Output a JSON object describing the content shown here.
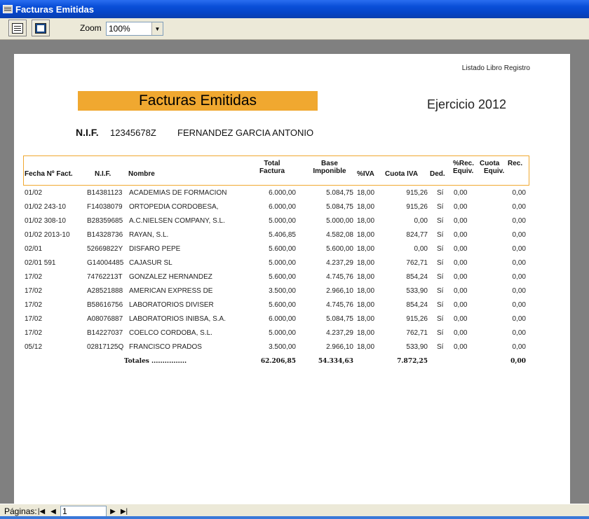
{
  "window": {
    "title": "Facturas Emitidas"
  },
  "toolbar": {
    "print_icon": "printer-icon",
    "close_icon": "close-report-icon",
    "zoom_label": "Zoom",
    "zoom_value": "100%"
  },
  "report": {
    "top_right": "Listado Libro Registro",
    "banner": "Facturas Emitidas",
    "banner_color": "#f0a830",
    "exercise": "Ejercicio 2012",
    "nif_label": "N.I.F.",
    "nif_value": "12345678Z",
    "holder_name": "FERNANDEZ GARCIA ANTONIO",
    "headers": {
      "fecha": "Fecha Nº Fact.",
      "nif": "N.I.F.",
      "nombre": "Nombre",
      "total_1": "Total",
      "total_2": "Factura",
      "base_1": "Base",
      "base_2": "Imponible",
      "iva": "%IVA",
      "cuota_iva": "Cuota IVA",
      "ded": "Ded.",
      "rec_1": "%Rec.",
      "rec_2": "Equiv.",
      "cuota_rec_1": "Cuota",
      "cuota_rec_2": "Equiv.",
      "rec_col": "Rec."
    },
    "rows": [
      {
        "fecha": "01/02",
        "nif": "B14381123",
        "nombre": "ACADEMIAS DE FORMACION",
        "total": "6.000,00",
        "base": "5.084,75",
        "iva": "18,00",
        "cuota": "915,26",
        "ded": "Sí",
        "rec": "0,00",
        "cuota_rec": "0,00"
      },
      {
        "fecha": "01/02 243-10",
        "nif": "F14038079",
        "nombre": "ORTOPEDIA CORDOBESA,",
        "total": "6.000,00",
        "base": "5.084,75",
        "iva": "18,00",
        "cuota": "915,26",
        "ded": "Sí",
        "rec": "0,00",
        "cuota_rec": "0,00"
      },
      {
        "fecha": "01/02 308-10",
        "nif": "B28359685",
        "nombre": "A.C.NIELSEN COMPANY, S.L.",
        "total": "5.000,00",
        "base": "5.000,00",
        "iva": "18,00",
        "cuota": "0,00",
        "ded": "Sí",
        "rec": "0,00",
        "cuota_rec": "0,00"
      },
      {
        "fecha": "01/02 2013-10",
        "nif": "B14328736",
        "nombre": "RAYAN, S.L.",
        "total": "5.406,85",
        "base": "4.582,08",
        "iva": "18,00",
        "cuota": "824,77",
        "ded": "Sí",
        "rec": "0,00",
        "cuota_rec": "0,00"
      },
      {
        "fecha": "02/01",
        "nif": "52669822Y",
        "nombre": "DISFARO PEPE",
        "total": "5.600,00",
        "base": "5.600,00",
        "iva": "18,00",
        "cuota": "0,00",
        "ded": "Sí",
        "rec": "0,00",
        "cuota_rec": "0,00"
      },
      {
        "fecha": "02/01 591",
        "nif": "G14004485",
        "nombre": "CAJASUR SL",
        "total": "5.000,00",
        "base": "4.237,29",
        "iva": "18,00",
        "cuota": "762,71",
        "ded": "Sí",
        "rec": "0,00",
        "cuota_rec": "0,00"
      },
      {
        "fecha": "17/02",
        "nif": "74762213T",
        "nombre": "GONZALEZ HERNANDEZ",
        "total": "5.600,00",
        "base": "4.745,76",
        "iva": "18,00",
        "cuota": "854,24",
        "ded": "Sí",
        "rec": "0,00",
        "cuota_rec": "0,00"
      },
      {
        "fecha": "17/02",
        "nif": "A28521888",
        "nombre": "AMERICAN EXPRESS DE",
        "total": "3.500,00",
        "base": "2.966,10",
        "iva": "18,00",
        "cuota": "533,90",
        "ded": "Sí",
        "rec": "0,00",
        "cuota_rec": "0,00"
      },
      {
        "fecha": "17/02",
        "nif": "B58616756",
        "nombre": "LABORATORIOS DIVISER",
        "total": "5.600,00",
        "base": "4.745,76",
        "iva": "18,00",
        "cuota": "854,24",
        "ded": "Sí",
        "rec": "0,00",
        "cuota_rec": "0,00"
      },
      {
        "fecha": "17/02",
        "nif": "A08076887",
        "nombre": "LABORATORIOS INIBSA, S.A.",
        "total": "6.000,00",
        "base": "5.084,75",
        "iva": "18,00",
        "cuota": "915,26",
        "ded": "Sí",
        "rec": "0,00",
        "cuota_rec": "0,00"
      },
      {
        "fecha": "17/02",
        "nif": "B14227037",
        "nombre": "COELCO CORDOBA, S.L.",
        "total": "5.000,00",
        "base": "4.237,29",
        "iva": "18,00",
        "cuota": "762,71",
        "ded": "Sí",
        "rec": "0,00",
        "cuota_rec": "0,00"
      },
      {
        "fecha": "05/12",
        "nif": "02817125Q",
        "nombre": "FRANCISCO PRADOS",
        "total": "3.500,00",
        "base": "2.966,10",
        "iva": "18,00",
        "cuota": "533,90",
        "ded": "Sí",
        "rec": "0,00",
        "cuota_rec": "0,00"
      }
    ],
    "totals": {
      "label": "Totales ................",
      "total": "62.206,85",
      "base": "54.334,63",
      "cuota": "7.872,25",
      "cuota_rec": "0,00"
    }
  },
  "statusbar": {
    "pages_label": "Páginas:",
    "first_icon": "first-page-icon",
    "prev_icon": "prev-page-icon",
    "page_value": "1",
    "next_icon": "next-page-icon",
    "last_icon": "last-page-icon"
  }
}
